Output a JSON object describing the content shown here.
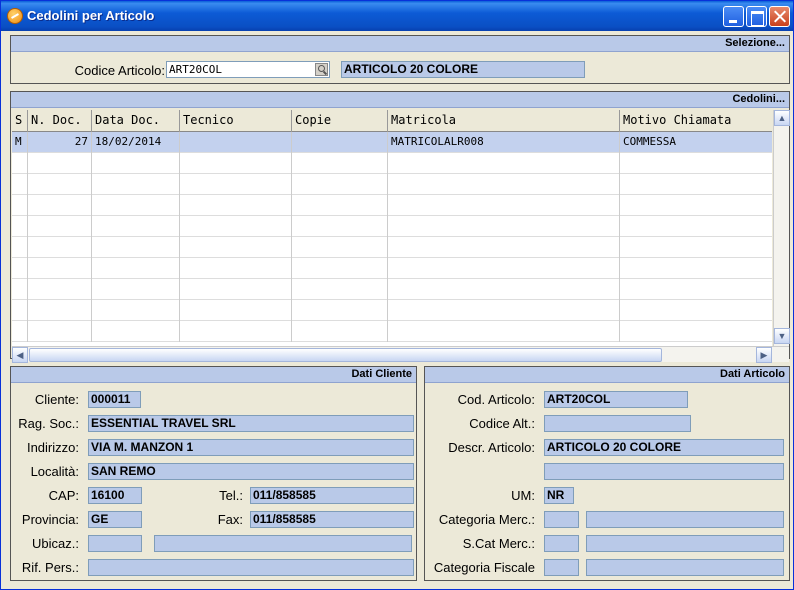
{
  "window": {
    "title": "Cedolini per Articolo"
  },
  "selezione": {
    "header": "Selezione...",
    "codice_label": "Codice Articolo:",
    "codice_value": "ART20COL",
    "descrizione": "ARTICOLO 20 COLORE"
  },
  "cedolini": {
    "header": "Cedolini...",
    "columns": [
      "S",
      "N. Doc.",
      "Data Doc.",
      "Tecnico",
      "Copie",
      "Matricola",
      "Motivo Chiamata"
    ],
    "rows": [
      {
        "s": "M",
        "n_doc": "27",
        "data_doc": "18/02/2014",
        "tecnico": "",
        "copie": "",
        "matricola": "MATRICOLALR008",
        "motivo": "COMMESSA"
      }
    ]
  },
  "dati_cliente": {
    "header": "Dati Cliente",
    "cliente_label": "Cliente:",
    "cliente": "000011",
    "rag_soc_label": "Rag. Soc.:",
    "rag_soc": "ESSENTIAL TRAVEL SRL",
    "indirizzo_label": "Indirizzo:",
    "indirizzo": "VIA M. MANZON 1",
    "localita_label": "Località:",
    "localita": "SAN REMO",
    "cap_label": "CAP:",
    "cap": "16100",
    "tel_label": "Tel.:",
    "tel": "011/858585",
    "provincia_label": "Provincia:",
    "provincia": "GE",
    "fax_label": "Fax:",
    "fax": "011/858585",
    "ubicaz_label": "Ubicaz.:",
    "ubicaz_code": "",
    "ubicaz_desc": "",
    "rif_pers_label": "Rif. Pers.:",
    "rif_pers": ""
  },
  "dati_articolo": {
    "header": "Dati Articolo",
    "cod_label": "Cod. Articolo:",
    "cod": "ART20COL",
    "cod_alt_label": "Codice Alt.:",
    "cod_alt": "",
    "descr_label": "Descr. Articolo:",
    "descr": "ARTICOLO 20 COLORE",
    "descr2": "",
    "um_label": "UM:",
    "um": "NR",
    "cat_merc_label": "Categoria Merc.:",
    "cat_merc_code": "",
    "cat_merc_desc": "",
    "scat_merc_label": "S.Cat Merc.:",
    "scat_merc_code": "",
    "scat_merc_desc": "",
    "cat_fisc_label": "Categoria Fiscale",
    "cat_fisc_code": "",
    "cat_fisc_desc": ""
  },
  "colors": {
    "title_bar": "#0a4fc4",
    "field_bg": "#b9c9e8",
    "window_bg": "#ece9d8",
    "selected_row": "#c3d1ee"
  }
}
